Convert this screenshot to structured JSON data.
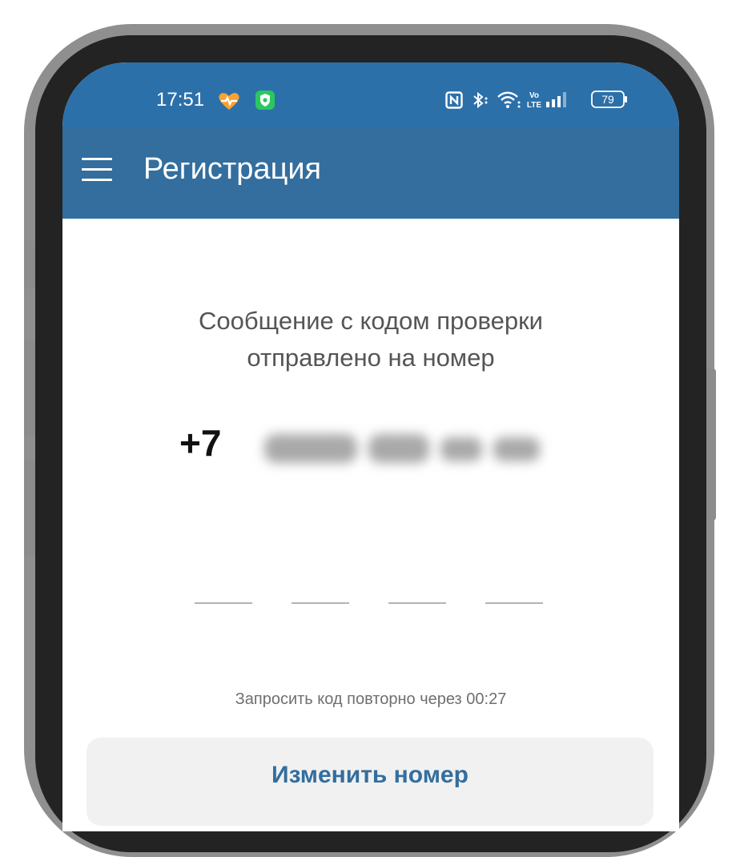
{
  "status_bar": {
    "time": "17:51",
    "battery": "79",
    "icons": [
      "heart-pulse-icon",
      "shield-icon",
      "nfc-icon",
      "bluetooth-icon",
      "wifi-icon",
      "volte-icon",
      "signal-icon",
      "battery-icon"
    ]
  },
  "app_bar": {
    "title": "Регистрация",
    "menu_icon": "hamburger-menu-icon"
  },
  "main": {
    "message_line1": "Сообщение с кодом проверки",
    "message_line2": "отправлено на номер",
    "phone_prefix": "+7",
    "code_slots": 4,
    "resend_text": "Запросить код повторно через 00:27",
    "change_number_label": "Изменить номер"
  },
  "colors": {
    "status_bar": "#2c70aa",
    "app_bar": "#336e9e",
    "accent": "#336e9e"
  }
}
